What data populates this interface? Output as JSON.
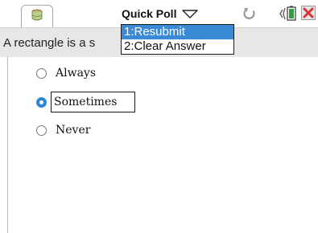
{
  "toolbar": {
    "menu_title": "Quick Poll",
    "icons": {
      "document_tab": "document-icon",
      "menu_caret": "chevron-down-icon",
      "refresh": "refresh-icon",
      "battery": "battery-icon",
      "close": "close-icon"
    }
  },
  "question": {
    "text": "A rectangle is a s"
  },
  "menu": {
    "items": [
      {
        "label": "1:Resubmit",
        "selected": true
      },
      {
        "label": "2:Clear Answer",
        "selected": false
      }
    ]
  },
  "options": [
    {
      "label": "Always",
      "selected": false
    },
    {
      "label": "Sometimes",
      "selected": true
    },
    {
      "label": "Never",
      "selected": false
    }
  ],
  "colors": {
    "accent": "#3a8ad6",
    "radio_selected": "#2e86d4",
    "question_bar": "#e7e7e7",
    "close_red": "#d9343b",
    "battery_green": "#2f9e3b"
  }
}
